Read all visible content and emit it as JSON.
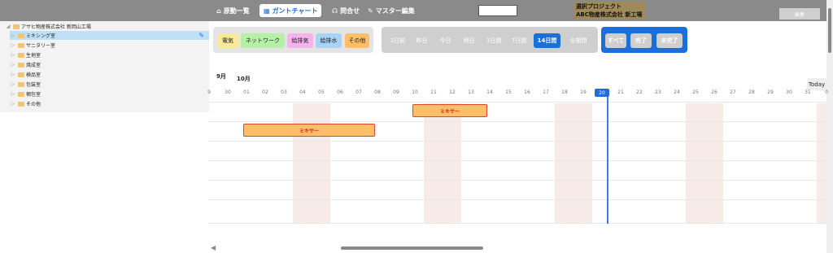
{
  "nav": {
    "items": [
      {
        "label": "原動一覧",
        "icon": "home-icon"
      },
      {
        "label": "ガントチャート",
        "icon": "calendar-icon",
        "active": true
      },
      {
        "label": "問合せ",
        "icon": "headset-icon"
      },
      {
        "label": "マスター編集",
        "icon": "edit-doc-icon"
      }
    ],
    "project_line1": "選択プロジェクト",
    "project_line2": "ABC物産株式会社 新工場",
    "edit_button": "編集"
  },
  "tree": {
    "root": "アサヒ物産株式会社 新岡山工場",
    "items": [
      {
        "label": "ミキシング室",
        "selected": true
      },
      {
        "label": "サニタリー室"
      },
      {
        "label": "生地室"
      },
      {
        "label": "焼成室"
      },
      {
        "label": "検品室"
      },
      {
        "label": "包装室"
      },
      {
        "label": "梱包室"
      },
      {
        "label": "その他"
      }
    ]
  },
  "filters": {
    "categories": [
      {
        "label": "電気",
        "color": "#f8e89a"
      },
      {
        "label": "ネットワーク",
        "color": "#b6f0a6"
      },
      {
        "label": "給排気",
        "color": "#f5b2ec"
      },
      {
        "label": "給排水",
        "color": "#a9d3f5"
      },
      {
        "label": "その他",
        "color": "#fdbe6a"
      }
    ],
    "periods": [
      {
        "label": "3日前"
      },
      {
        "label": "昨日"
      },
      {
        "label": "今日"
      },
      {
        "label": "明日"
      },
      {
        "label": "3日間"
      },
      {
        "label": "7日間"
      },
      {
        "label": "14日間"
      },
      {
        "label": "全期間",
        "active": true
      }
    ],
    "status": [
      {
        "label": "すべて",
        "active": true
      },
      {
        "label": "完了"
      },
      {
        "label": "未完了"
      }
    ]
  },
  "timeline": {
    "month_sep": "9月",
    "month_oct": "10月",
    "days": [
      "9",
      "30",
      "01",
      "02",
      "03",
      "04",
      "05",
      "06",
      "07",
      "08",
      "09",
      "10",
      "11",
      "12",
      "13",
      "14",
      "15",
      "16",
      "17",
      "18",
      "19",
      "20",
      "21",
      "22",
      "23",
      "24",
      "25",
      "26",
      "27",
      "28",
      "29",
      "30",
      "31",
      "0"
    ],
    "today_day": "20",
    "today_button": "Today"
  },
  "tasks": [
    {
      "label": "ミキサー",
      "start_day": "11",
      "end_day": "14"
    },
    {
      "label": "ミキサー",
      "start_day": "02",
      "end_day": "08"
    }
  ]
}
